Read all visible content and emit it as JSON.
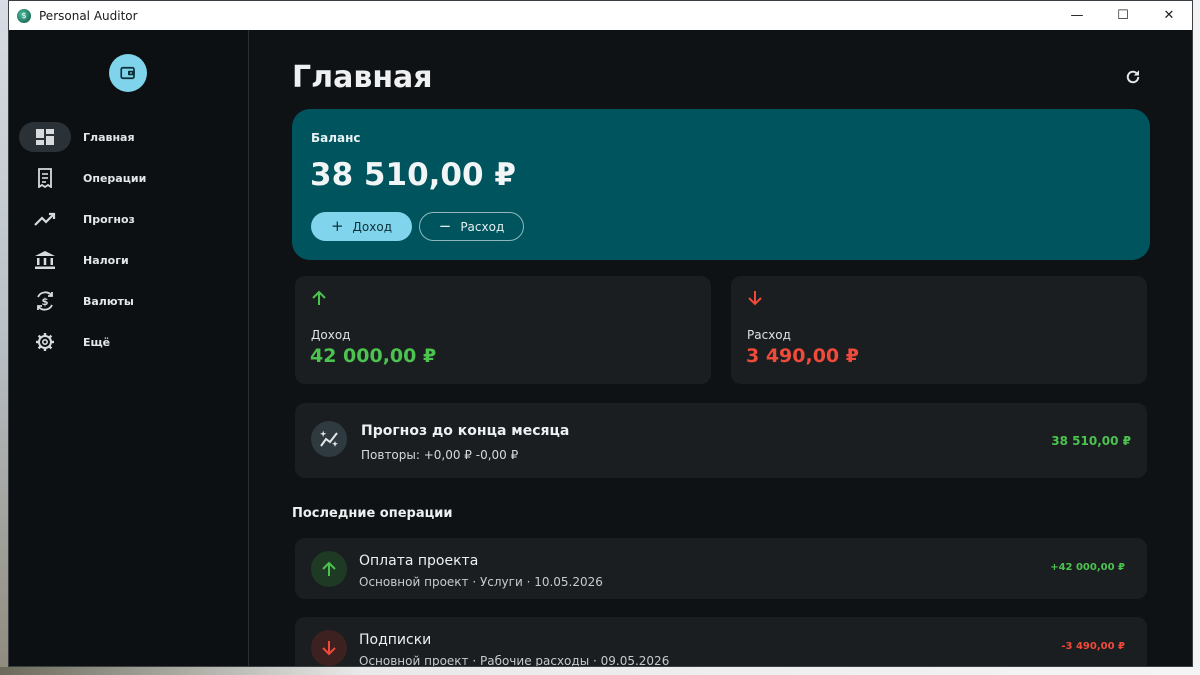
{
  "window": {
    "title": "Personal Auditor",
    "controls": {
      "minimize": "—",
      "maximize": "☐",
      "close": "✕"
    }
  },
  "sidebar": {
    "avatar_icon": "wallet-icon",
    "items": [
      {
        "label": "Главная",
        "icon": "dashboard-icon",
        "active": true
      },
      {
        "label": "Операции",
        "icon": "receipt-icon",
        "active": false
      },
      {
        "label": "Прогноз",
        "icon": "trending-up-icon",
        "active": false
      },
      {
        "label": "Налоги",
        "icon": "bank-icon",
        "active": false
      },
      {
        "label": "Валюты",
        "icon": "currency-exchange-icon",
        "active": false
      },
      {
        "label": "Ещё",
        "icon": "gear-icon",
        "active": false
      }
    ]
  },
  "main": {
    "title": "Главная",
    "balance": {
      "label": "Баланс",
      "value": "38 510,00 ₽",
      "income_button": "Доход",
      "expense_button": "Расход",
      "income_button_icon": "+",
      "expense_button_icon": "−"
    },
    "income": {
      "label": "Доход",
      "value": "42 000,00 ₽"
    },
    "expense": {
      "label": "Расход",
      "value": "3 490,00 ₽"
    },
    "forecast": {
      "title": "Прогноз до конца месяца",
      "subtitle": "Повторы: +0,00 ₽ -0,00 ₽",
      "value": "38 510,00 ₽"
    },
    "recent_title": "Последние операции",
    "operations": [
      {
        "title": "Оплата проекта",
        "subtitle": "Основной проект · Услуги · 10.05.2026",
        "amount": "+42 000,00 ₽",
        "type": "income"
      },
      {
        "title": "Подписки",
        "subtitle": "Основной проект · Рабочие расходы · 09.05.2026",
        "amount": "-3 490,00 ₽",
        "type": "expense"
      }
    ]
  },
  "colors": {
    "accent": "#80d4eb",
    "balance_card": "#00545e",
    "income": "#4cc24f",
    "expense": "#f04a3a",
    "background": "#0f1214",
    "card": "#1a1e21"
  }
}
